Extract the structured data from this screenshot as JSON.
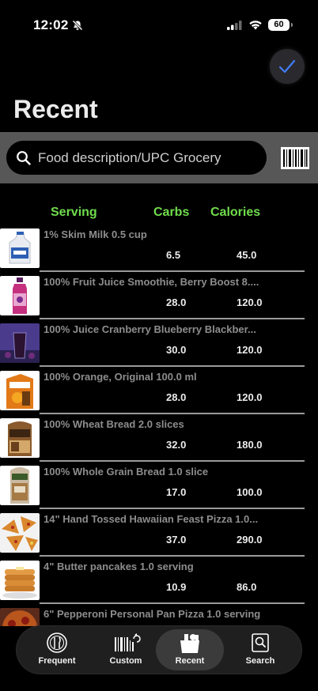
{
  "status_bar": {
    "time": "12:02",
    "battery": "60"
  },
  "header": {
    "title": "Recent"
  },
  "search": {
    "placeholder": "Food description/UPC Grocery"
  },
  "columns": {
    "serving": "Serving",
    "carbs": "Carbs",
    "calories": "Calories"
  },
  "foods": [
    {
      "name": "1% Skim Milk 0.5 cup",
      "carbs": "6.5",
      "calories": "45.0",
      "thumb_icon": "milk-jug-icon"
    },
    {
      "name": "100% Fruit Juice Smoothie, Berry Boost 8....",
      "carbs": "28.0",
      "calories": "120.0",
      "thumb_icon": "smoothie-bottle-icon"
    },
    {
      "name": "100% Juice Cranberry Blueberry Blackber...",
      "carbs": "30.0",
      "calories": "120.0",
      "thumb_icon": "juice-glass-icon"
    },
    {
      "name": "100% Orange, Original 100.0 ml",
      "carbs": "28.0",
      "calories": "120.0",
      "thumb_icon": "orange-juice-carton-icon"
    },
    {
      "name": "100% Wheat Bread 2.0 slices",
      "carbs": "32.0",
      "calories": "180.0",
      "thumb_icon": "wheat-bread-icon"
    },
    {
      "name": "100% Whole Grain Bread 1.0 slice",
      "carbs": "17.0",
      "calories": "100.0",
      "thumb_icon": "grain-bread-icon"
    },
    {
      "name": "14\" Hand Tossed Hawaiian Feast Pizza 1.0...",
      "carbs": "37.0",
      "calories": "290.0",
      "thumb_icon": "pizza-icon"
    },
    {
      "name": "4\" Butter pancakes 1.0 serving",
      "carbs": "10.9",
      "calories": "86.0",
      "thumb_icon": "pancakes-icon"
    },
    {
      "name": "6\" Pepperoni Personal Pan Pizza 1.0 serving",
      "carbs": "",
      "calories": "",
      "thumb_icon": "pan-pizza-icon"
    }
  ],
  "tabs": [
    {
      "label": "Frequent",
      "icon": "plate-utensils-icon",
      "active": false
    },
    {
      "label": "Custom",
      "icon": "custom-barcode-icon",
      "active": false
    },
    {
      "label": "Recent",
      "icon": "groceries-bag-icon",
      "active": true
    },
    {
      "label": "Search",
      "icon": "search-doc-icon",
      "active": false
    }
  ],
  "colors": {
    "accent_green": "#6fdc4c",
    "check_blue": "#3f7df5",
    "background": "#000000",
    "search_band": "#575757"
  }
}
